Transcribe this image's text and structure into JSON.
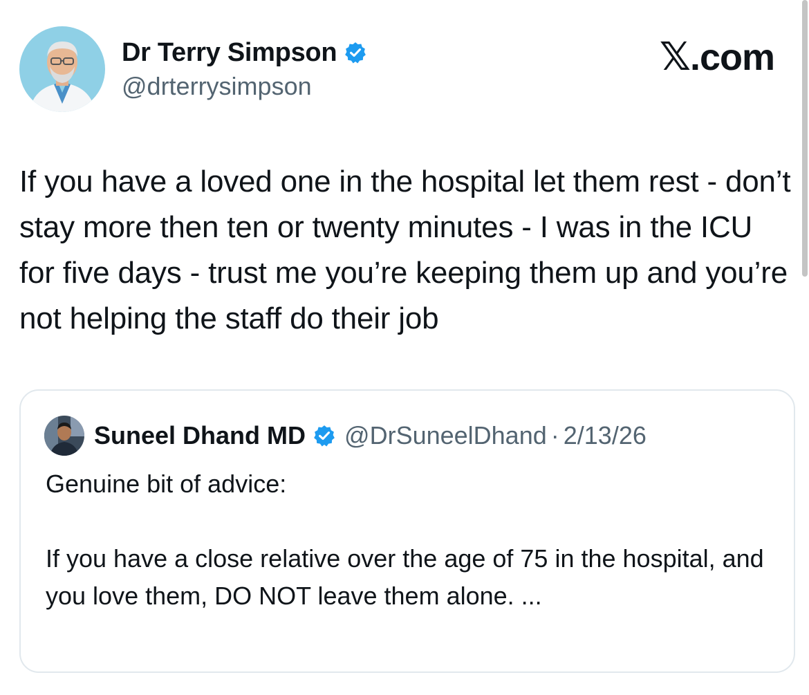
{
  "tweet": {
    "author_name": "Dr Terry Simpson",
    "author_handle": "@drterrysimpson",
    "text": "If you have a loved one in the hospital let them rest - don’t stay more then ten or twenty minutes - I was in the ICU for five days - trust me you’re keeping them up and you’re not helping the staff do their job",
    "avatar_icon": "doctor-portrait",
    "verified_icon": "verified-badge-icon"
  },
  "brand": {
    "x_glyph": "𝕏",
    "suffix": ".com"
  },
  "quoted_tweet": {
    "author_name": "Suneel Dhand MD",
    "author_handle": "@DrSuneelDhand",
    "separator": "·",
    "date": "2/13/26",
    "text": "Genuine bit of advice:\n\nIf you have a close relative over the age of 75 in the hospital, and you love them, DO NOT leave them alone. ...",
    "avatar_icon": "doctor-portrait-small",
    "verified_icon": "verified-badge-icon"
  },
  "colors": {
    "verified_blue": "#1d9bf0",
    "text_primary": "#0f1419",
    "text_secondary": "#536471",
    "card_border": "#e1e8ed"
  }
}
